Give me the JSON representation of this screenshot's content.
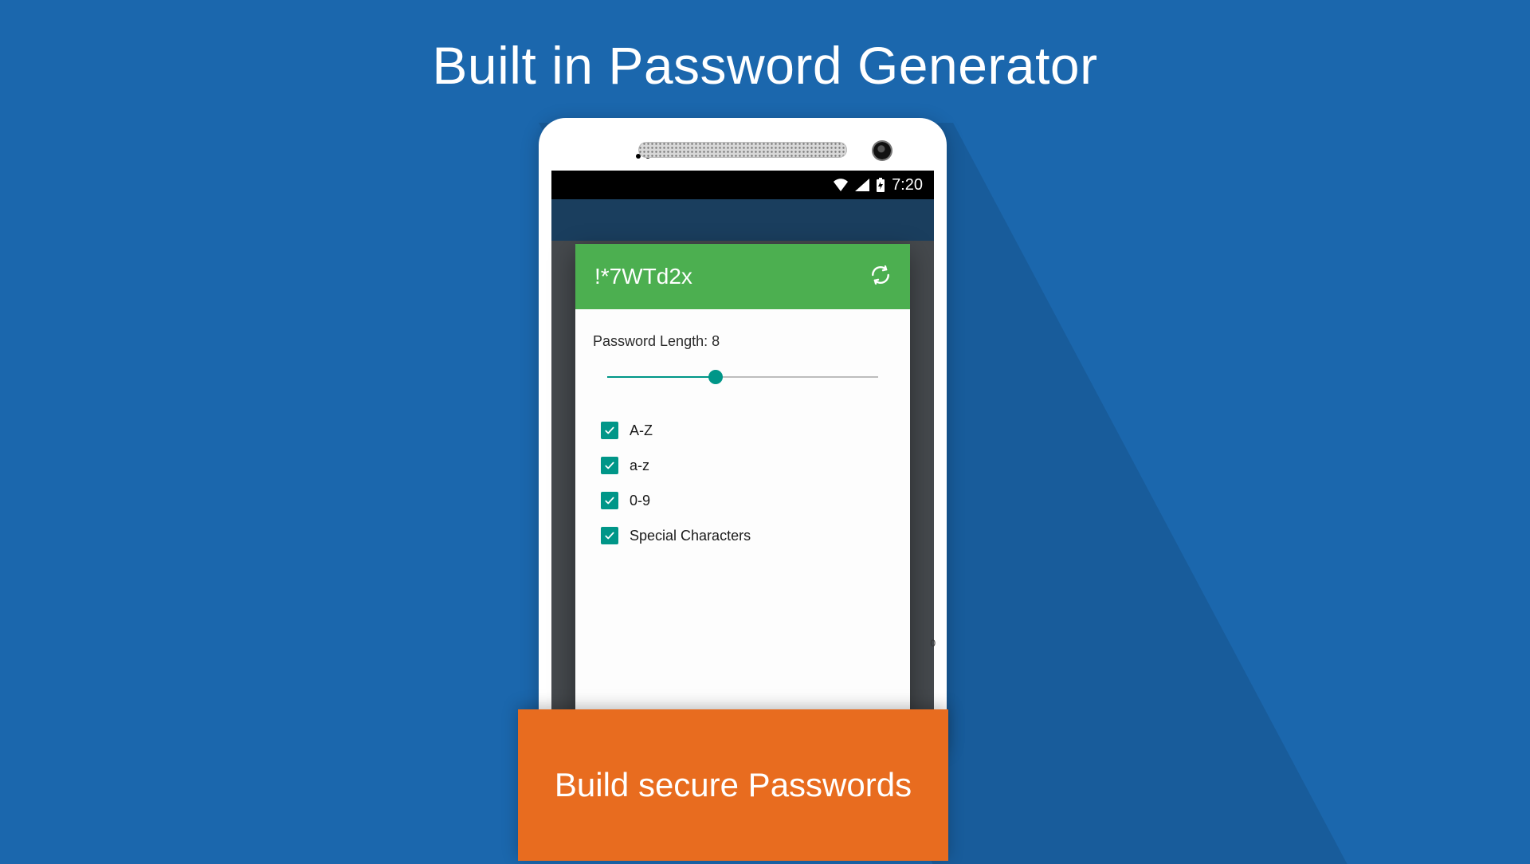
{
  "title": "Built in Password Generator",
  "banner": "Build secure Passwords",
  "status_bar": {
    "time": "7:20"
  },
  "generator": {
    "password": "!*7WTd2x",
    "length_label": "Password Length:",
    "length_value": "8",
    "slider_percent": 40,
    "options": [
      {
        "label": "A-Z",
        "checked": true
      },
      {
        "label": "a-z",
        "checked": true
      },
      {
        "label": "0-9",
        "checked": true
      },
      {
        "label": "Special Characters",
        "checked": true
      }
    ]
  },
  "colors": {
    "bg": "#1b67ad",
    "accent_green": "#4caf50",
    "accent_teal": "#009688",
    "banner": "#e86c1f"
  }
}
